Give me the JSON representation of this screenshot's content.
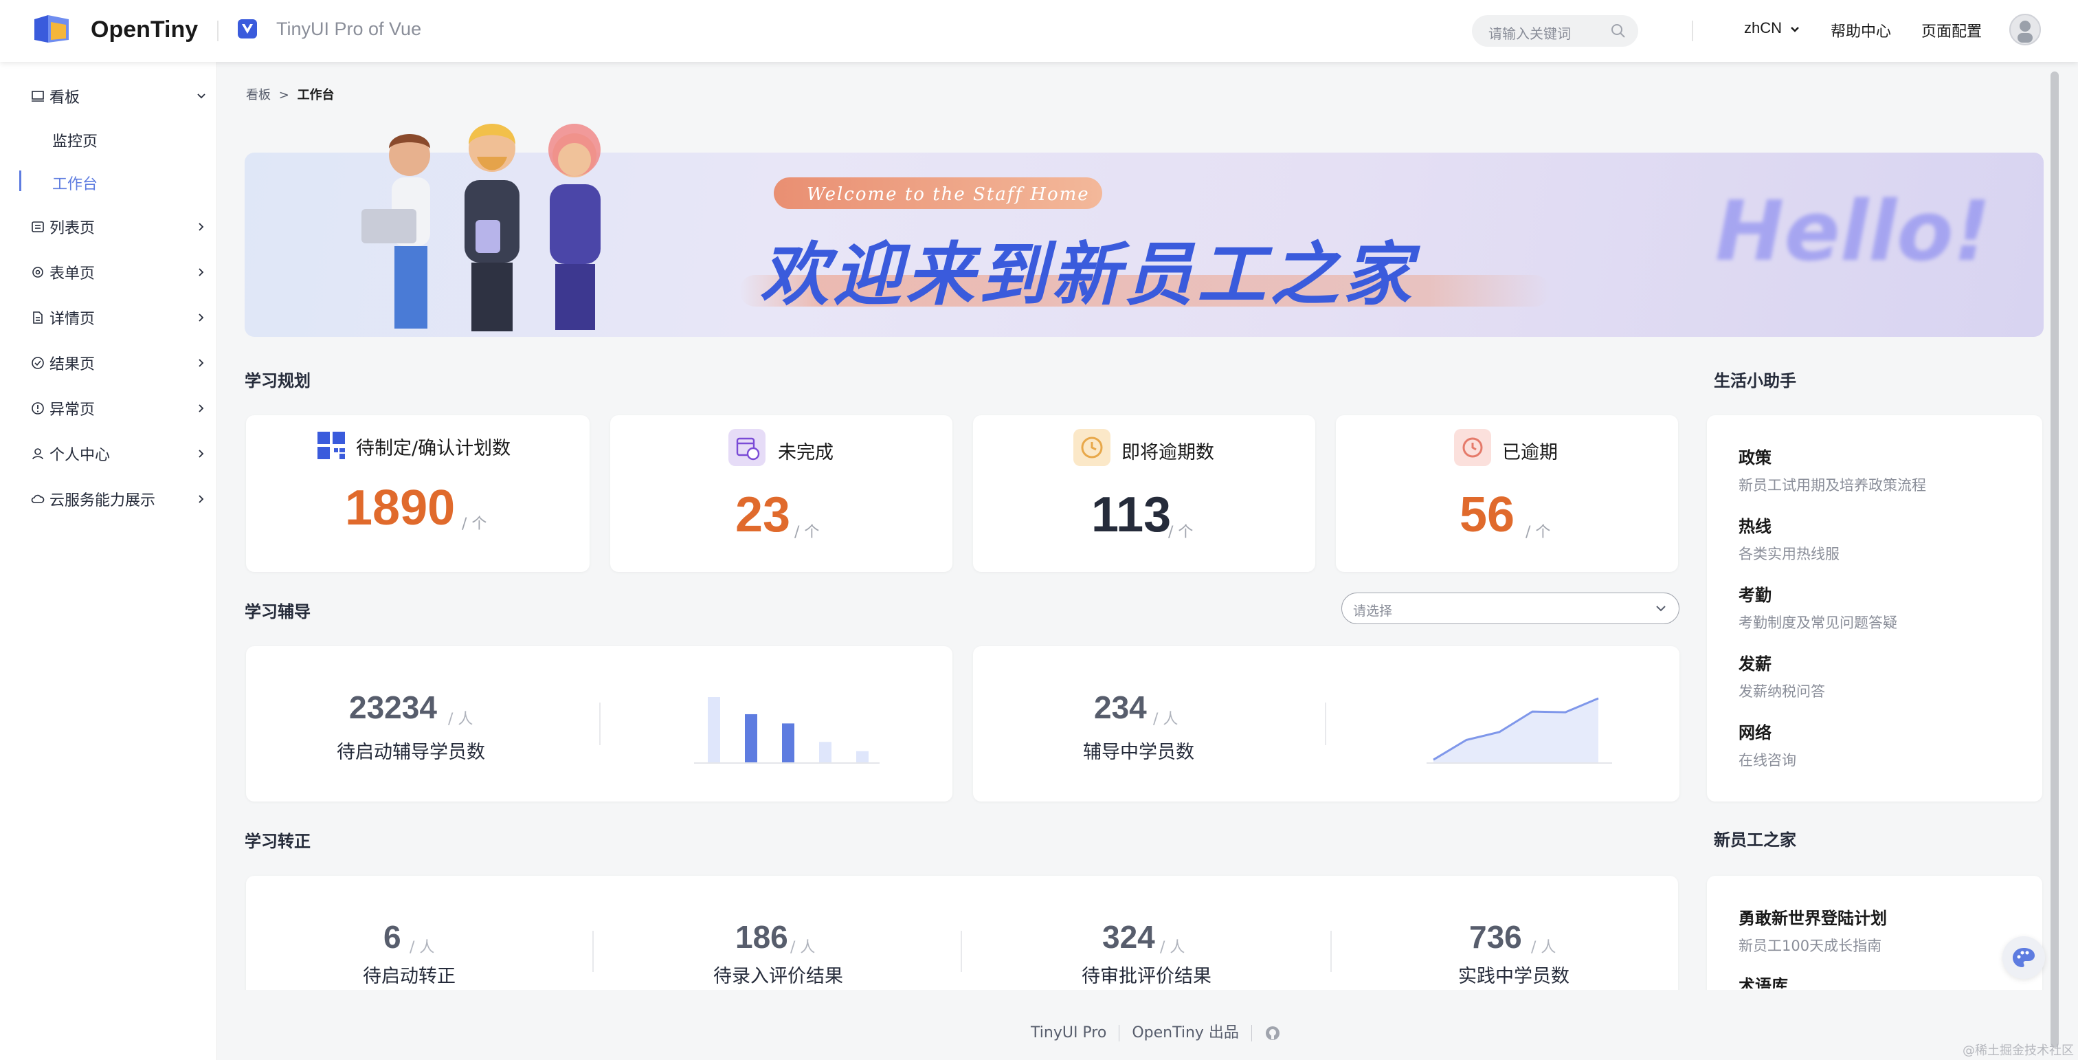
{
  "header": {
    "brand": "OpenTiny",
    "subbrand": "TinyUI Pro of Vue",
    "search_placeholder": "请输入关键词",
    "lang": "zhCN",
    "help": "帮助中心",
    "page_config": "页面配置"
  },
  "sidebar": {
    "items": [
      {
        "label": "看板",
        "icon": "monitor-icon"
      },
      {
        "label": "列表页",
        "icon": "list-icon"
      },
      {
        "label": "表单页",
        "icon": "gear-icon"
      },
      {
        "label": "详情页",
        "icon": "document-icon"
      },
      {
        "label": "结果页",
        "icon": "check-circle-icon"
      },
      {
        "label": "异常页",
        "icon": "exclamation-circle-icon"
      },
      {
        "label": "个人中心",
        "icon": "user-icon"
      },
      {
        "label": "云服务能力展示",
        "icon": "cloud-icon"
      }
    ],
    "subitems": [
      {
        "label": "监控页"
      },
      {
        "label": "工作台"
      }
    ]
  },
  "breadcrumb": {
    "root": "看板",
    "sep": ">",
    "current": "工作台"
  },
  "banner": {
    "welcome": "Welcome to the Staff Home",
    "title": "欢迎来到新员工之家",
    "hello": "Hello!"
  },
  "learning_plan": {
    "title": "学习规划",
    "stats": [
      {
        "label": "待制定/确认计划数",
        "value": "1890",
        "unit": "/ 个"
      },
      {
        "label": "未完成",
        "value": "23",
        "unit": "/ 个"
      },
      {
        "label": "即将逾期数",
        "value": "113",
        "unit": "/ 个"
      },
      {
        "label": "已逾期",
        "value": "56",
        "unit": "/ 个"
      }
    ]
  },
  "tutoring": {
    "title": "学习辅导",
    "select_placeholder": "请选择",
    "cards": [
      {
        "value": "23234",
        "unit": "/ 人",
        "label": "待启动辅导学员数"
      },
      {
        "value": "234",
        "unit": "/ 人",
        "label": "辅导中学员数"
      }
    ],
    "bar_values": [
      1.0,
      0.74,
      0.6,
      0.32,
      0.18
    ],
    "line_values": [
      0.05,
      0.35,
      0.47,
      0.78,
      0.77,
      0.98
    ]
  },
  "regularization": {
    "title": "学习转正",
    "stats": [
      {
        "value": "6",
        "unit": "/ 人",
        "label": "待启动转正"
      },
      {
        "value": "186",
        "unit": "/ 人",
        "label": "待录入评价结果"
      },
      {
        "value": "324",
        "unit": "/ 人",
        "label": "待审批评价结果"
      },
      {
        "value": "736",
        "unit": "/ 人",
        "label": "实践中学员数"
      }
    ]
  },
  "life_helper": {
    "title": "生活小助手",
    "items": [
      {
        "title": "政策",
        "desc": "新员工试用期及培养政策流程"
      },
      {
        "title": "热线",
        "desc": "各类实用热线服"
      },
      {
        "title": "考勤",
        "desc": "考勤制度及常见问题答疑"
      },
      {
        "title": "发薪",
        "desc": "发薪纳税问答"
      },
      {
        "title": "网络",
        "desc": "在线咨询"
      }
    ]
  },
  "new_staff_home": {
    "title": "新员工之家",
    "items": [
      {
        "title": "勇敢新世界登陆计划",
        "desc": "新员工100天成长指南"
      },
      {
        "title": "术语库"
      }
    ]
  },
  "footer": {
    "left": "TinyUI Pro",
    "right": "OpenTiny 出品"
  },
  "watermark": "@稀土掘金技术社区",
  "colors": {
    "accent": "#5e7ce0",
    "orange": "#e06a2c",
    "brand_blue": "#3a5bdc"
  }
}
